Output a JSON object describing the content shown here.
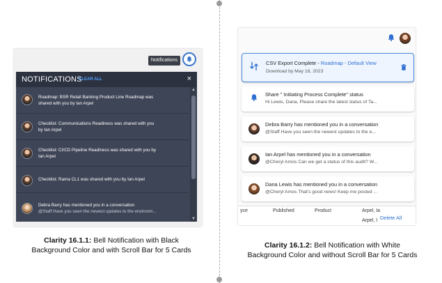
{
  "left": {
    "tooltip": "Notifications",
    "header": {
      "title": "NOTIFICATIONS",
      "clear_all": "CLEAR ALL",
      "close": "×"
    },
    "cards": [
      {
        "line1": "Roadmap: BSR Retail Banking Product Line Roadmap was",
        "line2": "shared with you by Ian Arpel"
      },
      {
        "line1": "Checklist: Communications Readiness was shared with you",
        "line2": "by Ian Arpel"
      },
      {
        "line1": "Checklist: CI/CD Pipeline Readiness was shared with you by",
        "line2": "Ian Arpel"
      },
      {
        "line1": "Checklist: Rama CL1 was shared with you by Ian Arpel",
        "line2": ""
      },
      {
        "line1": "Debra Barry has mentioned you in a conversation",
        "line2": "@Staff Have you seen the newest updates to the environm..."
      }
    ],
    "caption": {
      "bold": "Clarity 16.1.1:",
      "line1": " Bell Notification with Black",
      "line2": "Background Color and with Scroll Bar for 5 Cards"
    }
  },
  "right": {
    "cards": [
      {
        "title": "CSV Export Complete - ",
        "link": "Roadmap - Default View",
        "sub": "Download by May 18, 2023"
      },
      {
        "title": "Share \" Initiating Process Complete\" status",
        "sub": "Hi Lewis, Dana, Please share the latest status of Ta..."
      },
      {
        "title": "Debra Barry has mentioned you in a conversation",
        "sub": "@Staff Have you seen the newest updates to the e..."
      },
      {
        "title": "Ian Arpel has mentioned you in a conversation",
        "sub": "@Cheryl Amos Can we get a status of this audit? W..."
      },
      {
        "title": "Dana Lewis has mentioned you in a conversation",
        "sub": "@Cheryl Amos That's good news! Keep me posted ..."
      }
    ],
    "table": {
      "col1": "yce",
      "col2": "Published",
      "col3": "Product",
      "col4": "Arpel, Ia",
      "col5": "Arpel, Ian"
    },
    "delete_all": "Delete All",
    "caption": {
      "bold": "Clarity 16.1.2:",
      "line1": " Bell Notification with White",
      "line2": "Background Color and without Scroll Bar for 5 Cards"
    }
  }
}
